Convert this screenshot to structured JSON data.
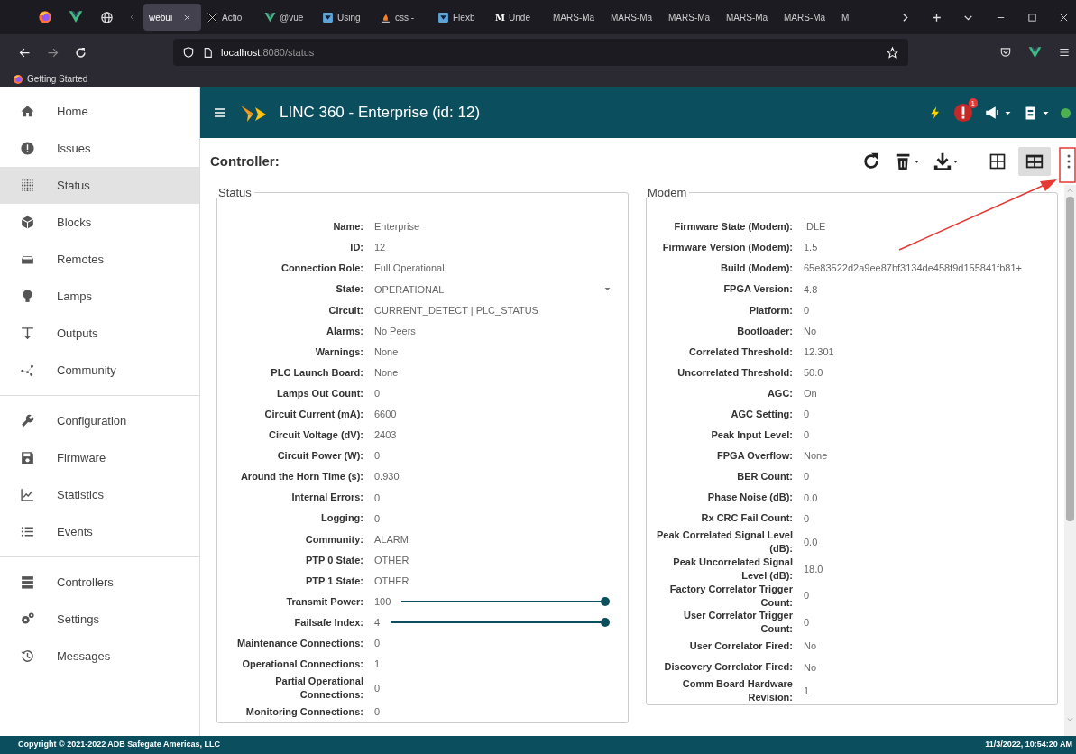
{
  "browser": {
    "pinned_tabs": [
      {
        "kind": "firefox"
      },
      {
        "kind": "vue"
      },
      {
        "kind": "globe"
      }
    ],
    "tabs": [
      {
        "label": "webui",
        "kind": "plain",
        "selected": true
      },
      {
        "label": "Actio",
        "kind": "x",
        "selected": false
      },
      {
        "label": "@vue",
        "kind": "vue",
        "selected": false
      },
      {
        "label": "Using",
        "kind": "box",
        "selected": false
      },
      {
        "label": "css -",
        "kind": "flame",
        "selected": false
      },
      {
        "label": "Flexb",
        "kind": "box",
        "selected": false
      },
      {
        "label": "Unde",
        "kind": "letter",
        "favicon": "M",
        "selected": false
      },
      {
        "label": "MARS-Ma",
        "kind": "plain",
        "selected": false
      },
      {
        "label": "MARS-Ma",
        "kind": "plain",
        "selected": false
      },
      {
        "label": "MARS-Ma",
        "kind": "plain",
        "selected": false
      },
      {
        "label": "MARS-Ma",
        "kind": "plain",
        "selected": false
      },
      {
        "label": "MARS-Ma",
        "kind": "plain",
        "selected": false
      },
      {
        "label": "M",
        "kind": "plain",
        "selected": false
      }
    ],
    "url_host": "localhost",
    "url_path": ":8080/status",
    "bookmarks": [
      "Getting Started"
    ]
  },
  "header": {
    "title": "LINC 360 - Enterprise (id: 12)",
    "alert_count": "1",
    "connected": true
  },
  "sidebar": {
    "groups": [
      {
        "items": [
          {
            "label": "Home",
            "kind": "home",
            "selected": false
          },
          {
            "label": "Issues",
            "kind": "issues",
            "selected": false
          },
          {
            "label": "Status",
            "kind": "status",
            "selected": true
          },
          {
            "label": "Blocks",
            "kind": "blocks",
            "selected": false
          },
          {
            "label": "Remotes",
            "kind": "remotes",
            "selected": false
          },
          {
            "label": "Lamps",
            "kind": "lamps",
            "selected": false
          },
          {
            "label": "Outputs",
            "kind": "outputs",
            "selected": false
          },
          {
            "label": "Community",
            "kind": "community",
            "selected": false
          }
        ]
      },
      {
        "items": [
          {
            "label": "Configuration",
            "kind": "configuration",
            "selected": false
          },
          {
            "label": "Firmware",
            "kind": "firmware",
            "selected": false
          },
          {
            "label": "Statistics",
            "kind": "statistics",
            "selected": false
          },
          {
            "label": "Events",
            "kind": "events",
            "selected": false
          }
        ]
      },
      {
        "items": [
          {
            "label": "Controllers",
            "kind": "controllers",
            "selected": false
          },
          {
            "label": "Settings",
            "kind": "settings",
            "selected": false
          },
          {
            "label": "Messages",
            "kind": "messages",
            "selected": false
          }
        ]
      }
    ]
  },
  "page": {
    "title": "Controller:",
    "actions": [
      {
        "kind": "refresh"
      },
      {
        "kind": "delete"
      },
      {
        "kind": "download"
      }
    ],
    "views": [
      {
        "kind": "grid",
        "selected": false
      },
      {
        "kind": "split",
        "selected": true
      }
    ]
  },
  "panels": [
    {
      "title": "Status",
      "rows": [
        {
          "label": "Name:",
          "value": "Enterprise",
          "kind": "text"
        },
        {
          "label": "ID:",
          "value": "12",
          "kind": "text"
        },
        {
          "label": "Connection Role:",
          "value": "Full Operational",
          "kind": "text"
        },
        {
          "label": "State:",
          "value": "OPERATIONAL",
          "kind": "select"
        },
        {
          "label": "Circuit:",
          "value": "CURRENT_DETECT | PLC_STATUS",
          "kind": "text"
        },
        {
          "label": "Alarms:",
          "value": "No Peers",
          "kind": "text"
        },
        {
          "label": "Warnings:",
          "value": "None",
          "kind": "text"
        },
        {
          "label": "PLC Launch Board:",
          "value": "None",
          "kind": "text"
        },
        {
          "label": "Lamps Out Count:",
          "value": "0",
          "kind": "text"
        },
        {
          "label": "Circuit Current (mA):",
          "value": "6600",
          "kind": "text"
        },
        {
          "label": "Circuit Voltage (dV):",
          "value": "2403",
          "kind": "text"
        },
        {
          "label": "Circuit Power (W):",
          "value": "0",
          "kind": "text"
        },
        {
          "label": "Around the Horn Time (s):",
          "value": "0.930",
          "kind": "text"
        },
        {
          "label": "Internal Errors:",
          "value": "0",
          "kind": "text"
        },
        {
          "label": "Logging:",
          "value": "0",
          "kind": "text"
        },
        {
          "label": "Community:",
          "value": "ALARM",
          "kind": "text"
        },
        {
          "label": "PTP 0 State:",
          "value": "OTHER",
          "kind": "text"
        },
        {
          "label": "PTP 1 State:",
          "value": "OTHER",
          "kind": "text"
        },
        {
          "label": "Transmit Power:",
          "value": "100",
          "kind": "slider",
          "level": 1
        },
        {
          "label": "Failsafe Index:",
          "value": "4",
          "kind": "slider",
          "level": 1
        },
        {
          "label": "Maintenance Connections:",
          "value": "0",
          "kind": "text"
        },
        {
          "label": "Operational Connections:",
          "value": "1",
          "kind": "text"
        },
        {
          "label": "Partial Operational Connections:",
          "value": "0",
          "kind": "text"
        },
        {
          "label": "Monitoring Connections:",
          "value": "0",
          "kind": "text"
        }
      ]
    },
    {
      "title": "Modem",
      "rows": [
        {
          "label": "Firmware State (Modem):",
          "value": "IDLE",
          "kind": "text"
        },
        {
          "label": "Firmware Version (Modem):",
          "value": "1.5",
          "kind": "text"
        },
        {
          "label": "Build (Modem):",
          "value": "65e83522d2a9ee87bf3134de458f9d155841fb81+",
          "kind": "text"
        },
        {
          "label": "FPGA Version:",
          "value": "4.8",
          "kind": "text"
        },
        {
          "label": "Platform:",
          "value": "0",
          "kind": "text"
        },
        {
          "label": "Bootloader:",
          "value": "No",
          "kind": "text"
        },
        {
          "label": "Correlated Threshold:",
          "value": "12.301",
          "kind": "text"
        },
        {
          "label": "Uncorrelated Threshold:",
          "value": "50.0",
          "kind": "text"
        },
        {
          "label": "AGC:",
          "value": "On",
          "kind": "text"
        },
        {
          "label": "AGC Setting:",
          "value": "0",
          "kind": "text"
        },
        {
          "label": "Peak Input Level:",
          "value": "0",
          "kind": "text"
        },
        {
          "label": "FPGA Overflow:",
          "value": "None",
          "kind": "text"
        },
        {
          "label": "BER Count:",
          "value": "0",
          "kind": "text"
        },
        {
          "label": "Phase Noise (dB):",
          "value": "0.0",
          "kind": "text"
        },
        {
          "label": "Rx CRC Fail Count:",
          "value": "0",
          "kind": "text"
        },
        {
          "label": "Peak Correlated Signal Level (dB):",
          "value": "0.0",
          "kind": "text"
        },
        {
          "label": "Peak Uncorrelated Signal Level (dB):",
          "value": "18.0",
          "kind": "text"
        },
        {
          "label": "Factory Correlator Trigger Count:",
          "value": "0",
          "kind": "text"
        },
        {
          "label": "User Correlator Trigger Count:",
          "value": "0",
          "kind": "text"
        },
        {
          "label": "User Correlator Fired:",
          "value": "No",
          "kind": "text"
        },
        {
          "label": "Discovery Correlator Fired:",
          "value": "No",
          "kind": "text"
        },
        {
          "label": "Comm Board Hardware Revision:",
          "value": "1",
          "kind": "text"
        }
      ]
    }
  ],
  "footer": {
    "copyright": "Copyright © 2021-2022 ADB Safegate Americas, LLC",
    "timestamp": "11/3/2022, 10:54:20 AM"
  }
}
